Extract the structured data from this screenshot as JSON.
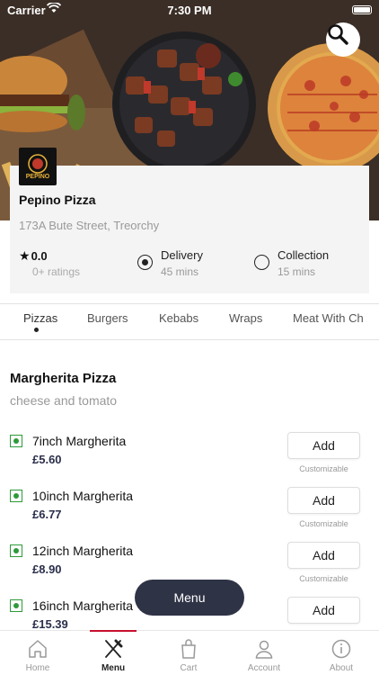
{
  "status": {
    "carrier": "Carrier",
    "time": "7:30 PM"
  },
  "restaurant": {
    "name": "Pepino Pizza",
    "logo_text": "PEPINO",
    "address": "173A Bute Street, Treorchy",
    "rating": "0.0",
    "rating_count": "0+ ratings"
  },
  "order_options": [
    {
      "label": "Delivery",
      "time": "45 mins",
      "selected": true
    },
    {
      "label": "Collection",
      "time": "15 mins",
      "selected": false
    }
  ],
  "tabs": [
    "Pizzas",
    "Burgers",
    "Kebabs",
    "Wraps",
    "Meat With Ch"
  ],
  "category": {
    "title": "Margherita Pizza",
    "description": "cheese and tomato"
  },
  "items": [
    {
      "name": "7inch Margherita",
      "price": "£5.60",
      "button": "Add",
      "note": "Customizable"
    },
    {
      "name": "10inch Margherita",
      "price": "£6.77",
      "button": "Add",
      "note": "Customizable"
    },
    {
      "name": "12inch Margherita",
      "price": "£8.90",
      "button": "Add",
      "note": "Customizable"
    },
    {
      "name": "16inch Margherita",
      "price": "£15.39",
      "button": "Add",
      "note": ""
    }
  ],
  "menu_button": "Menu",
  "nav": [
    {
      "label": "Home",
      "icon": "home-icon"
    },
    {
      "label": "Menu",
      "icon": "utensils-icon",
      "active": true
    },
    {
      "label": "Cart",
      "icon": "bag-icon"
    },
    {
      "label": "Account",
      "icon": "user-icon"
    },
    {
      "label": "About",
      "icon": "info-icon"
    }
  ],
  "colors": {
    "accent": "#c8102e",
    "dark": "#2f3346",
    "veg": "#2e9a3b"
  }
}
